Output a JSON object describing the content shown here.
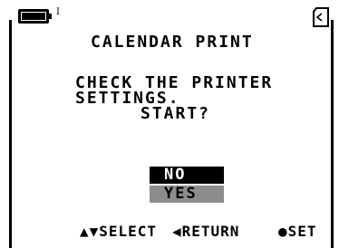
{
  "status": {
    "battery_icon": "battery-full-icon",
    "battery_mark": "I",
    "card_icon": "memory-card-icon"
  },
  "screen": {
    "title": "CALENDAR PRINT",
    "message_lines": [
      "CHECK THE PRINTER",
      "SETTINGS.",
      "START?"
    ]
  },
  "menu": {
    "options": [
      {
        "label": "NO",
        "selected": true
      },
      {
        "label": "YES",
        "selected": false
      }
    ]
  },
  "help": {
    "select": "▲▼SELECT",
    "return": "◀RETURN",
    "set": "●SET"
  },
  "colors": {
    "background": "#ffffff",
    "highlight": "#000000",
    "option_bg": "#8c8c8c"
  }
}
